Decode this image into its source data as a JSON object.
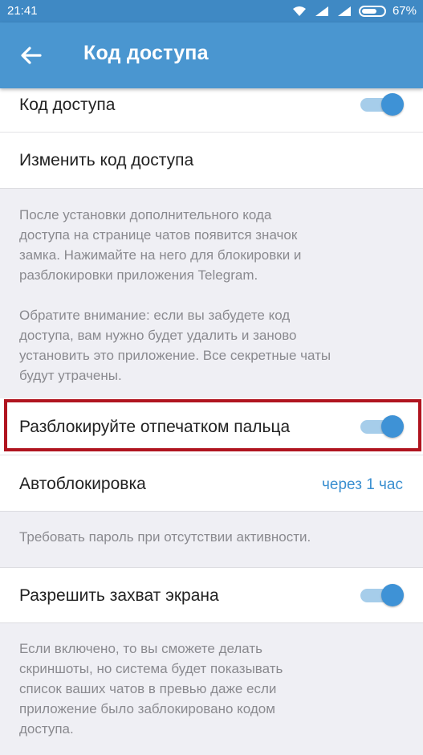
{
  "status_bar": {
    "time": "21:41",
    "battery": "67%",
    "icons": [
      "wifi-icon",
      "signal-icon",
      "signal-icon",
      "battery-icon"
    ]
  },
  "app_bar": {
    "title": "Код доступа",
    "back_icon": "arrow-left-icon"
  },
  "settings": {
    "passcode_label": "Код доступа",
    "passcode_enabled": true,
    "change_passcode_label": "Изменить код доступа",
    "passcode_note": "После установки дополнительного кода\nдоступа на странице чатов появится значок\nзамка. Нажимайте на него для блокировки и\nразблокировки приложения Telegram.\n\nОбратите внимание: если вы забудете код\nдоступа, вам нужно будет удалить и заново\nустановить это приложение. Все секретные чаты\nбудут утрачены.",
    "fingerprint_label": "Разблокируйте отпечатком пальца",
    "fingerprint_enabled": true,
    "autolock_label": "Автоблокировка",
    "autolock_value": "через 1 час",
    "autolock_note": "Требовать пароль при отсутствии активности.",
    "screen_capture_label": "Разрешить захват экрана",
    "screen_capture_enabled": true,
    "screen_capture_note": "Если включено, то вы сможете делать\nскриншоты, но система будет показывать\nсписок ваших чатов в превью даже если\nприложение было заблокировано кодом\nдоступа."
  },
  "colors": {
    "app_bar": "#4a96d0",
    "status_bar": "#3f89c4",
    "accent": "#3e92d6",
    "highlight": "#b0141f"
  }
}
